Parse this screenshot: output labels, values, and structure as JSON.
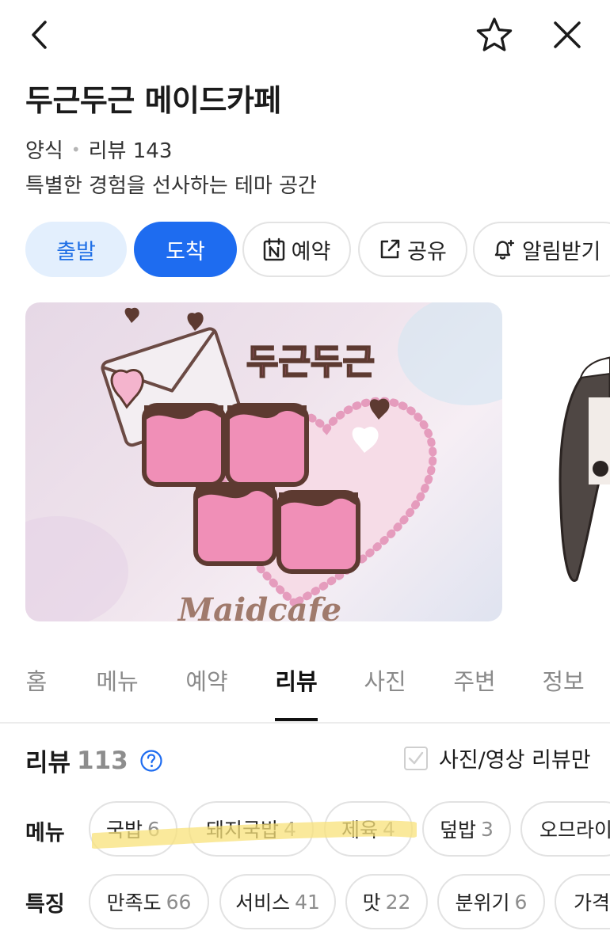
{
  "header": {
    "back_icon": "chevron-left-icon",
    "favorite_icon": "star-outline-icon",
    "close_icon": "close-icon"
  },
  "place": {
    "title": "두근두근 메이드카페",
    "category": "양식",
    "review_label": "리뷰 143",
    "description": "특별한 경험을 선사하는 테마 공간"
  },
  "actions": {
    "depart": "출발",
    "arrive": "도착",
    "reserve": "예약",
    "share": "공유",
    "alarm": "알림받기"
  },
  "photo": {
    "logo_top": "두근두근",
    "logo_bottom": "Maidcafe"
  },
  "tabs": [
    {
      "label": "홈"
    },
    {
      "label": "메뉴"
    },
    {
      "label": "예약"
    },
    {
      "label": "리뷰"
    },
    {
      "label": "사진"
    },
    {
      "label": "주변"
    },
    {
      "label": "정보"
    }
  ],
  "active_tab": "리뷰",
  "reviews": {
    "label": "리뷰",
    "count": "113",
    "photo_only_label": "사진/영상 리뷰만",
    "photo_only_checked": false,
    "menu_label": "메뉴",
    "menu_chips": [
      {
        "name": "국밥",
        "count": "6"
      },
      {
        "name": "돼지국밥",
        "count": "4"
      },
      {
        "name": "제육",
        "count": "4"
      },
      {
        "name": "덮밥",
        "count": "3"
      },
      {
        "name": "오므라이",
        "count": ""
      }
    ],
    "feature_label": "특징",
    "feature_chips": [
      {
        "name": "만족도",
        "count": "66"
      },
      {
        "name": "서비스",
        "count": "41"
      },
      {
        "name": "맛",
        "count": "22"
      },
      {
        "name": "분위기",
        "count": "6"
      },
      {
        "name": "가격",
        "count": ""
      }
    ]
  },
  "colors": {
    "primary_blue": "#1e6cf0",
    "light_blue": "#e3effd",
    "highlight_yellow": "#f8e27a"
  }
}
